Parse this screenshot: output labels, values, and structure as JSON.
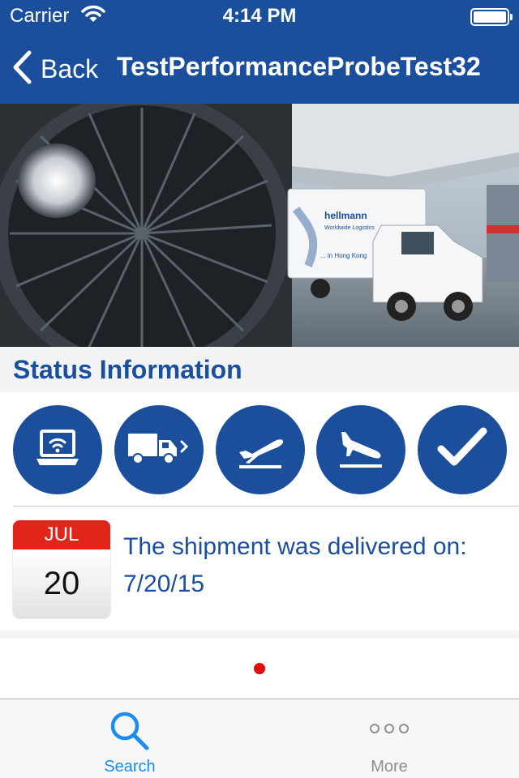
{
  "status_bar": {
    "carrier": "Carrier",
    "time": "4:14 PM"
  },
  "nav": {
    "back_label": "Back",
    "title": "TestPerformanceProbeTest32"
  },
  "hero": {
    "truck_brand": "hellmann",
    "truck_tagline": "Worldwide Logistics",
    "truck_location": "... in Hong Kong"
  },
  "section": {
    "title": "Status Information"
  },
  "status_steps": [
    {
      "icon": "laptop-wifi-icon"
    },
    {
      "icon": "truck-icon"
    },
    {
      "icon": "plane-takeoff-icon"
    },
    {
      "icon": "plane-landing-icon"
    },
    {
      "icon": "checkmark-icon"
    }
  ],
  "delivery": {
    "month": "JUL",
    "day": "20",
    "message": "The shipment was delivered on: 7/20/15"
  },
  "page_indicator": {
    "pages": 1,
    "current": 1
  },
  "tabs": [
    {
      "label": "Search",
      "icon": "search-icon",
      "active": true
    },
    {
      "label": "More",
      "icon": "more-icon",
      "active": false
    }
  ],
  "colors": {
    "brand_blue": "#1b4f9c",
    "active_tab": "#1a8cf0",
    "inactive_tab": "#8e8e93",
    "calendar_red": "#e1251b",
    "page_dot": "#e00b0b"
  }
}
